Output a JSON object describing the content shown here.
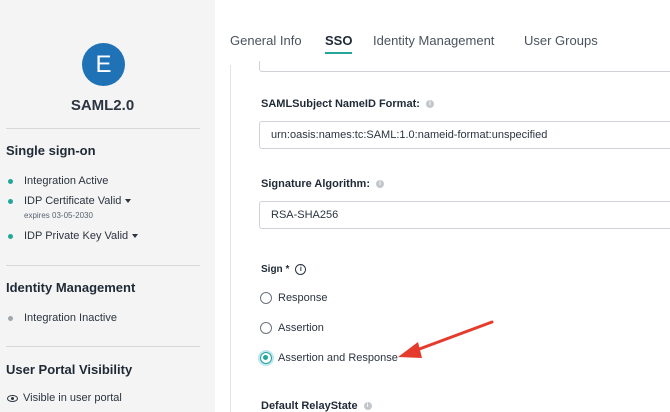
{
  "sidebar": {
    "avatar_letter": "E",
    "app_name": "SAML2.0",
    "sso": {
      "title": "Single sign-on",
      "items": [
        {
          "label": "Integration Active"
        },
        {
          "label": "IDP Certificate Valid",
          "sub": "expires 03-05-2030"
        },
        {
          "label": "IDP Private Key Valid"
        }
      ]
    },
    "identity": {
      "title": "Identity Management",
      "items": [
        {
          "label": "Integration Inactive"
        }
      ]
    },
    "portal": {
      "title": "User Portal Visibility",
      "items": [
        {
          "label": "Visible in user portal"
        }
      ]
    }
  },
  "tabs": [
    {
      "label": "General Info"
    },
    {
      "label": "SSO"
    },
    {
      "label": "Identity Management"
    },
    {
      "label": "User Groups"
    }
  ],
  "active_tab": "SSO",
  "form": {
    "nameid": {
      "label": "SAMLSubject NameID Format:",
      "value": "urn:oasis:names:tc:SAML:1.0:nameid-format:unspecified"
    },
    "signature": {
      "label": "Signature Algorithm:",
      "value": "RSA-SHA256"
    },
    "sign": {
      "label": "Sign *",
      "options": [
        {
          "label": "Response"
        },
        {
          "label": "Assertion"
        },
        {
          "label": "Assertion and Response"
        }
      ],
      "selected": "Assertion and Response"
    },
    "relay": {
      "label": "Default RelayState"
    }
  },
  "colors": {
    "accent": "#26a69a",
    "avatar": "#1e72b5",
    "annotation_arrow": "#e53b2c"
  }
}
